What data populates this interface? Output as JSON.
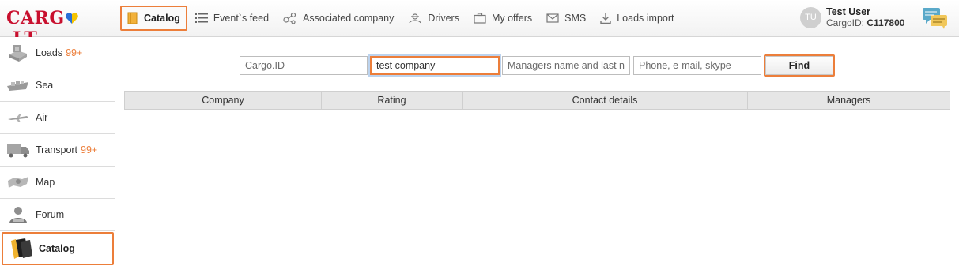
{
  "logo": {
    "text_left": "CARG",
    "text_right": ".LT"
  },
  "nav": [
    {
      "label": "Catalog",
      "icon": "catalog-icon"
    },
    {
      "label": "Event`s feed",
      "icon": "list-icon"
    },
    {
      "label": "Associated company",
      "icon": "share-icon"
    },
    {
      "label": "Drivers",
      "icon": "drivers-icon"
    },
    {
      "label": "My offers",
      "icon": "briefcase-icon"
    },
    {
      "label": "SMS",
      "icon": "envelope-icon"
    },
    {
      "label": "Loads import",
      "icon": "download-icon"
    }
  ],
  "user": {
    "initials": "TU",
    "name": "Test User",
    "cargo_id_label": "CargoID:",
    "cargo_id": "C117800"
  },
  "sidebar": [
    {
      "label": "Loads",
      "badge": "99+",
      "icon": "loads-icon"
    },
    {
      "label": "Sea",
      "badge": "",
      "icon": "ship-icon"
    },
    {
      "label": "Air",
      "badge": "",
      "icon": "plane-icon"
    },
    {
      "label": "Transport",
      "badge": "99+",
      "icon": "truck-icon"
    },
    {
      "label": "Map",
      "badge": "",
      "icon": "map-icon"
    },
    {
      "label": "Forum",
      "badge": "",
      "icon": "forum-icon"
    },
    {
      "label": "Catalog",
      "badge": "",
      "icon": "catalog-books-icon"
    }
  ],
  "search": {
    "cargo_id_placeholder": "Cargo.ID",
    "company_value": "test company",
    "managers_placeholder": "Managers name and last na",
    "contact_placeholder": "Phone, e-mail, skype",
    "find_label": "Find"
  },
  "table": {
    "columns": [
      "Company",
      "Rating",
      "Contact details",
      "Managers"
    ]
  },
  "colors": {
    "accent": "#ec7e3a",
    "brand": "#c8102e"
  }
}
